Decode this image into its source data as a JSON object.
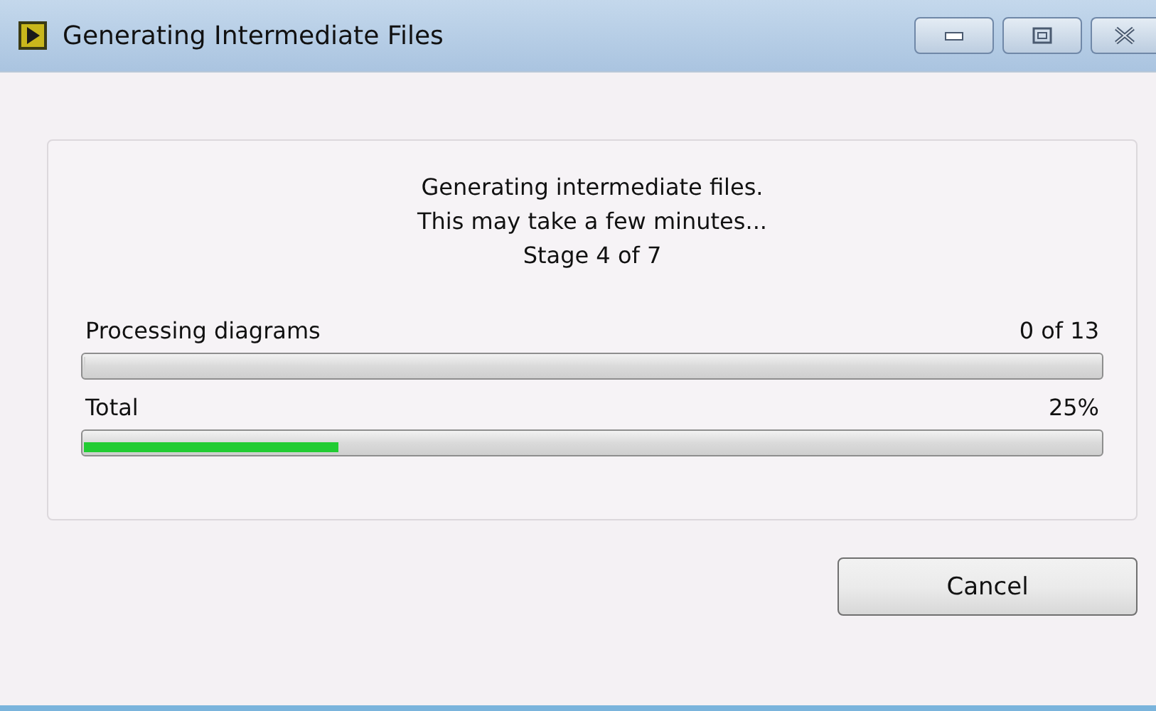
{
  "window": {
    "title": "Generating Intermediate Files"
  },
  "message": [
    "Generating intermediate files.",
    "This may take a few minutes...",
    "Stage 4 of 7"
  ],
  "progress": [
    {
      "label": "Processing diagrams",
      "reading": "0 of 13",
      "level": 0
    },
    {
      "label": "Total",
      "reading": "25%",
      "level": 0.25
    }
  ],
  "buttons": [
    "Cancel"
  ]
}
